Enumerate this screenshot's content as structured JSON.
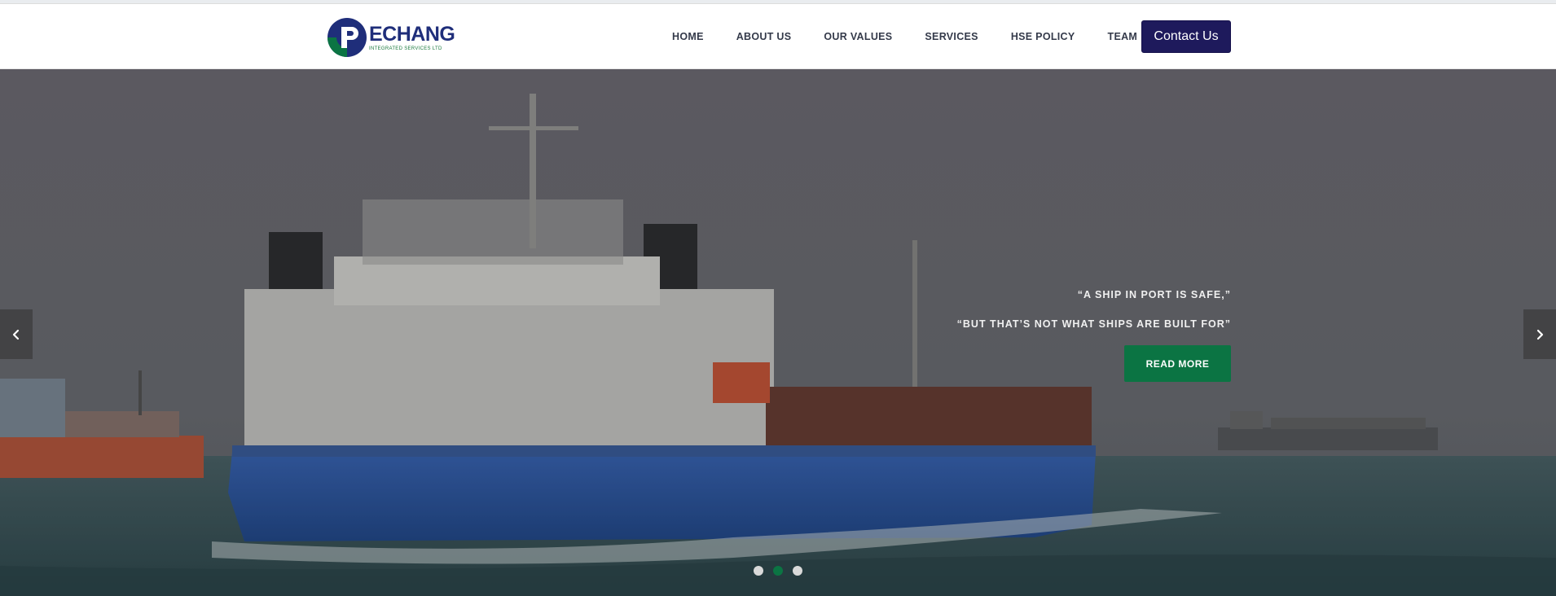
{
  "brand": {
    "name": "ECHANG",
    "tagline": "INTEGRATED SERVICES LTD",
    "primary_color": "#1f2e7a",
    "accent_color": "#0b7443"
  },
  "nav": {
    "items": [
      {
        "label": "HOME"
      },
      {
        "label": "ABOUT US"
      },
      {
        "label": "OUR VALUES"
      },
      {
        "label": "SERVICES"
      },
      {
        "label": "HSE POLICY"
      },
      {
        "label": "TEAM"
      }
    ],
    "contact_label": "Contact Us"
  },
  "hero": {
    "quote_line_1": "“A SHIP IN PORT IS SAFE,”",
    "quote_line_2": "“BUT THAT’S NOT WHAT SHIPS ARE BUILT FOR”",
    "read_more_label": "READ MORE",
    "prev_icon": "chevron-left-icon",
    "next_icon": "chevron-right-icon",
    "slides_total": 3,
    "active_slide": 2
  }
}
